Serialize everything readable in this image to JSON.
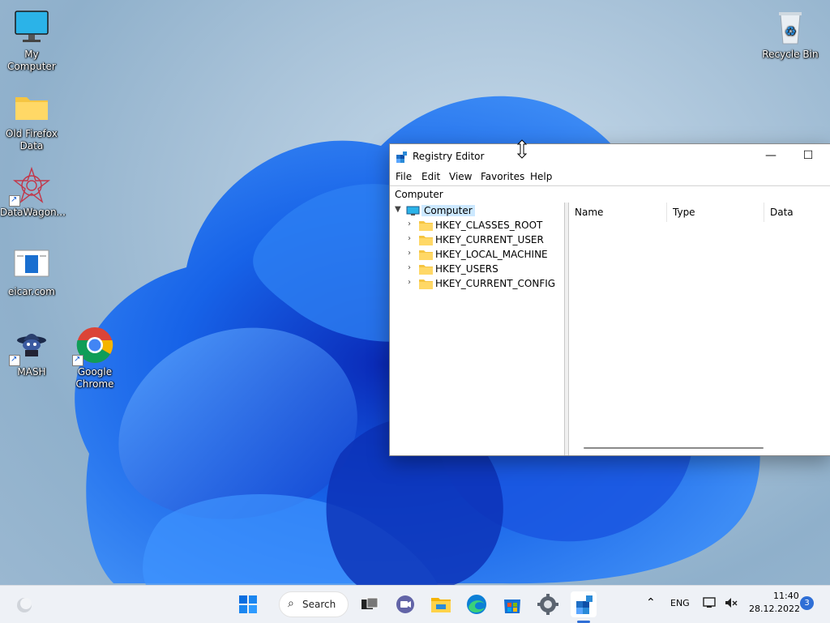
{
  "desktop": {
    "icons": [
      {
        "label": "My Computer",
        "icon": "monitor-icon"
      },
      {
        "label": "Old Firefox Data",
        "icon": "folder-icon"
      },
      {
        "label": "DataWagon...",
        "icon": "datawagon-icon"
      },
      {
        "label": "eicar.com",
        "icon": "document-icon"
      },
      {
        "label": "MASH",
        "icon": "mash-icon"
      },
      {
        "label": "Google Chrome",
        "icon": "chrome-icon"
      },
      {
        "label": "Recycle Bin",
        "icon": "recycle-bin-icon"
      }
    ]
  },
  "regedit": {
    "title": "Registry Editor",
    "minimize_glyph": "—",
    "maximize_glyph": "☐",
    "menu": [
      "File",
      "Edit",
      "View",
      "Favorites",
      "Help"
    ],
    "address": "Computer",
    "tree": {
      "root": "Computer",
      "keys": [
        "HKEY_CLASSES_ROOT",
        "HKEY_CURRENT_USER",
        "HKEY_LOCAL_MACHINE",
        "HKEY_USERS",
        "HKEY_CURRENT_CONFIG"
      ]
    },
    "columns": [
      "Name",
      "Type",
      "Data"
    ]
  },
  "taskbar": {
    "search_label": "Search",
    "language": "ENG",
    "time": "11:40",
    "date": "28.12.2022",
    "notification_count": "3"
  },
  "colors": {
    "accent": "#2f6fd6",
    "folder": "#f5c542",
    "selection": "#cce8ff"
  }
}
